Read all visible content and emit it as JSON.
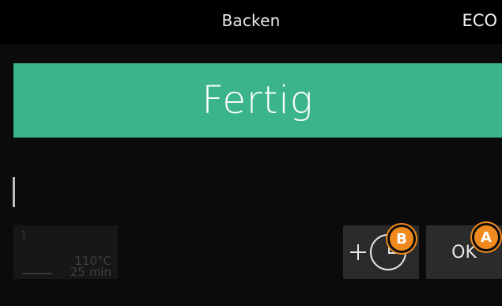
{
  "header": {
    "title": "Backen",
    "mode_badge": "ECO"
  },
  "banner": {
    "status_text": "Fertig",
    "color": "#3cb48a"
  },
  "step_card": {
    "step_number": "1",
    "temperature": "110°C",
    "duration": "25 min"
  },
  "actions": {
    "add_time_icon": "plus-clock-icon",
    "ok_label": "OK"
  },
  "markers": {
    "b_label": "B",
    "a_label": "A",
    "color": "#f08a1e"
  }
}
